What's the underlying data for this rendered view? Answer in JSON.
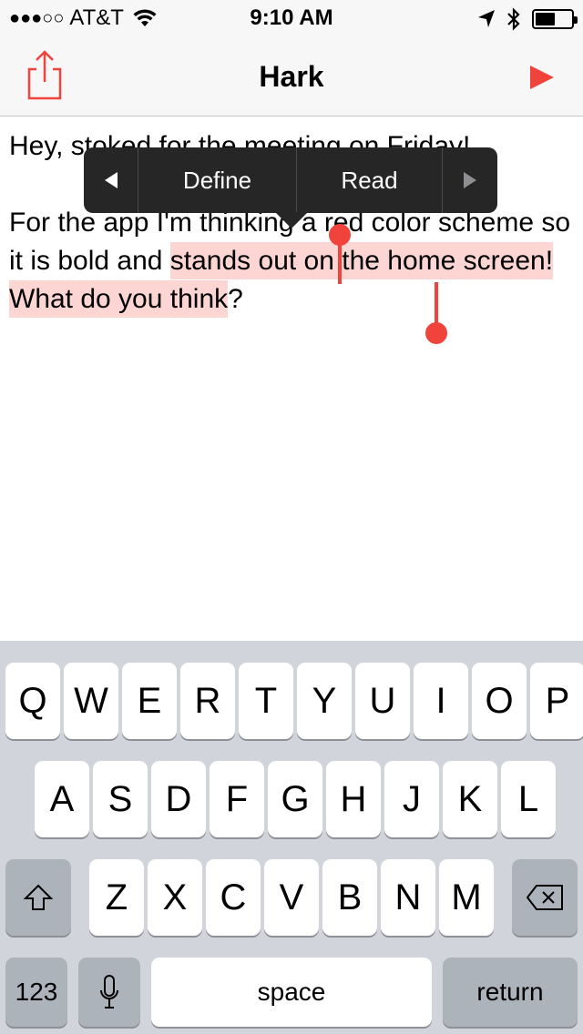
{
  "status_bar": {
    "signal": "●●●○○",
    "carrier": "AT&T",
    "time": "9:10 AM",
    "battery_level": 0.55,
    "icons": [
      "signal-dots-icon",
      "wifi-icon",
      "location-arrow-icon",
      "bluetooth-icon",
      "battery-icon"
    ]
  },
  "nav": {
    "title": "Hark",
    "share_icon": "share-icon",
    "play_icon": "play-icon",
    "accent_color": "#f0433b"
  },
  "note": {
    "paragraph1": "Hey, stoked for the meeting on Friday!",
    "paragraph2_before": "For the app I'm thinking a red color scheme so it is bold and ",
    "paragraph2_selected": "stands out on the home screen! What do you think",
    "paragraph2_after": "?",
    "selection_color": "#fdd5d3"
  },
  "edit_menu": {
    "items": [
      "Define",
      "Read"
    ],
    "prev_icon": "triangle-left-icon",
    "next_icon": "triangle-right-icon"
  },
  "keyboard": {
    "row1": [
      "Q",
      "W",
      "E",
      "R",
      "T",
      "Y",
      "U",
      "I",
      "O",
      "P"
    ],
    "row2": [
      "A",
      "S",
      "D",
      "F",
      "G",
      "H",
      "J",
      "K",
      "L"
    ],
    "row3": [
      "Z",
      "X",
      "C",
      "V",
      "B",
      "N",
      "M"
    ],
    "numbers_label": "123",
    "space_label": "space",
    "return_label": "return",
    "shift_icon": "shift-icon",
    "delete_icon": "backspace-icon",
    "mic_icon": "microphone-icon"
  }
}
